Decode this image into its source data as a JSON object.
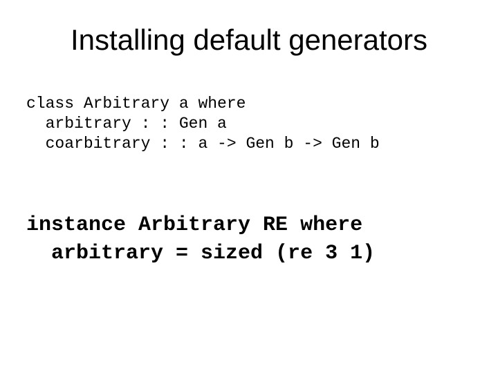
{
  "title": "Installing default generators",
  "code1_line1": "class Arbitrary a where",
  "code1_line2": "  arbitrary : : Gen a",
  "code1_line3": "  coarbitrary : : a -> Gen b -> Gen b",
  "code2_line1": "instance Arbitrary RE where",
  "code2_line2": "  arbitrary = sized (re 3 1)"
}
